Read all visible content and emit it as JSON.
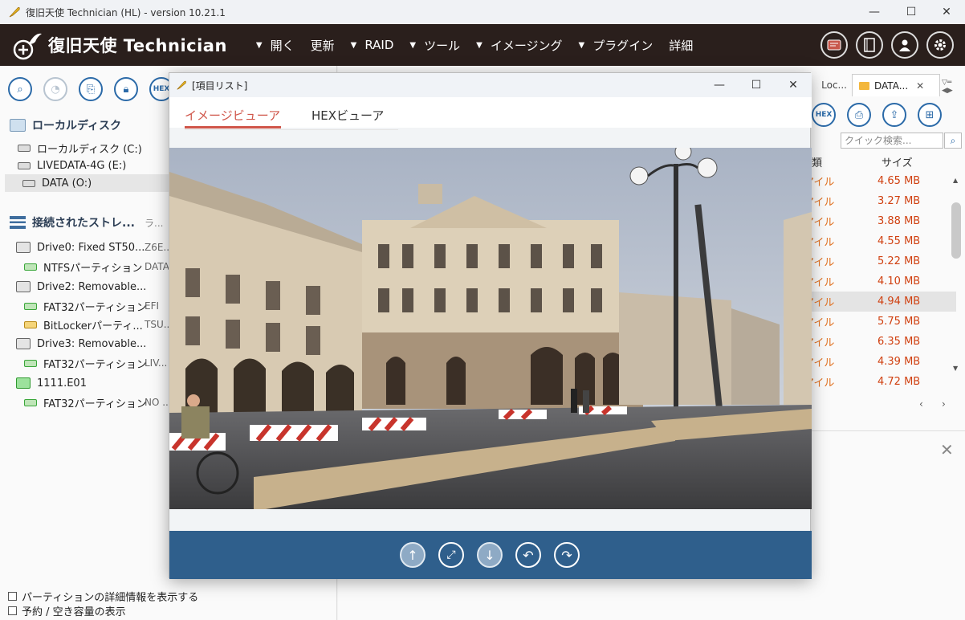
{
  "window": {
    "title": "復旧天使 Technician (HL) - version 10.21.1"
  },
  "app": {
    "brand": "復旧天使 Technician",
    "menu": [
      {
        "label": "開く",
        "caret": true
      },
      {
        "label": "更新",
        "caret": false
      },
      {
        "label": "RAID",
        "caret": true
      },
      {
        "label": "ツール",
        "caret": true
      },
      {
        "label": "イメージング",
        "caret": true
      },
      {
        "label": "プラグイン",
        "caret": true
      },
      {
        "label": "詳細",
        "caret": false
      }
    ]
  },
  "left": {
    "local_title": "ローカルディスク",
    "local_items": [
      "ローカルディスク (C:)",
      "LIVEDATA-4G (E:)",
      "DATA (O:)"
    ],
    "storage_title": "接続されたストレ...",
    "storage_aux": "ラ...",
    "storage_items": [
      {
        "label": "Drive0: Fixed ST50...",
        "aux": "Z6E..."
      },
      {
        "label": "NTFSパーティション",
        "aux": "DATA"
      },
      {
        "label": "Drive2: Removable...",
        "aux": ""
      },
      {
        "label": "FAT32パーティション",
        "aux": "EFI"
      },
      {
        "label": "BitLockerパーティ...",
        "aux": "TSU..."
      },
      {
        "label": "Drive3: Removable...",
        "aux": ""
      },
      {
        "label": "FAT32パーティション",
        "aux": "LIV..."
      },
      {
        "label": "1111.E01",
        "aux": ""
      },
      {
        "label": "FAT32パーティション",
        "aux": "NO ..."
      }
    ],
    "hex_label": "HEX",
    "checks": [
      "パーティションの詳細情報を表示する",
      "予約 / 空き容量の表示"
    ]
  },
  "right": {
    "tab_a": "Loc...",
    "tab_b": "DATA...",
    "hex_label": "HEX",
    "search_placeholder": "クイック検索...",
    "col_type": "類",
    "col_size": "サイズ",
    "rows": [
      {
        "type": "アイル",
        "size": "4.65 MB"
      },
      {
        "type": "アイル",
        "size": "3.27 MB"
      },
      {
        "type": "アイル",
        "size": "3.88 MB"
      },
      {
        "type": "アイル",
        "size": "4.55 MB"
      },
      {
        "type": "アイル",
        "size": "5.22 MB"
      },
      {
        "type": "アイル",
        "size": "4.10 MB"
      },
      {
        "type": "アイル",
        "size": "4.94 MB"
      },
      {
        "type": "アイル",
        "size": "5.75 MB"
      },
      {
        "type": "アイル",
        "size": "6.35 MB"
      },
      {
        "type": "アイル",
        "size": "4.39 MB"
      },
      {
        "type": "アイル",
        "size": "4.72 MB"
      }
    ],
    "selected_row": 6
  },
  "modal": {
    "title": "[項目リスト]",
    "tab_image": "イメージビューア",
    "tab_hex": "HEXビューア",
    "footer_buttons": [
      "up-arrow-icon",
      "fit-screen-icon",
      "down-arrow-icon",
      "rotate-left-icon",
      "rotate-right-icon"
    ]
  },
  "colors": {
    "appbar": "#2a1f1c",
    "accent_tab": "#d0564a",
    "footer": "#2f5f8c",
    "file_type": "#e07020",
    "file_size": "#d04010"
  }
}
